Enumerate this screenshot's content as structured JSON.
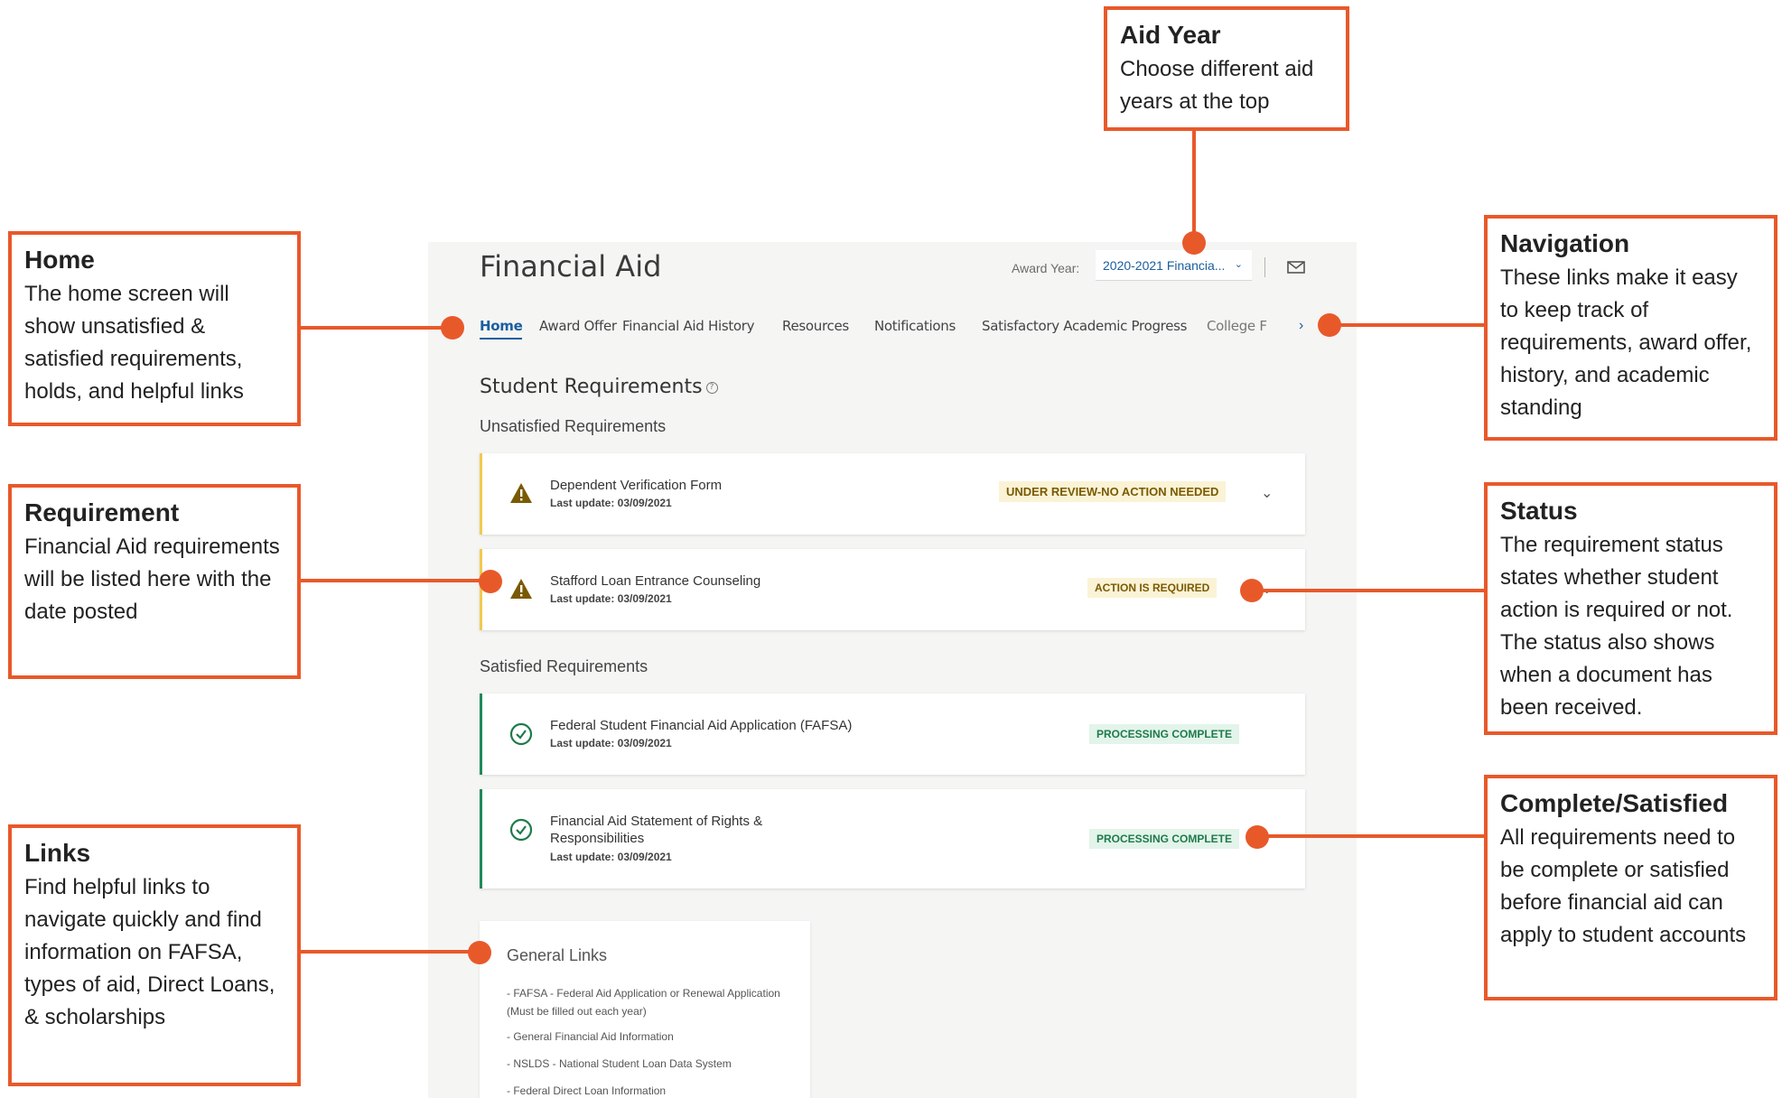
{
  "app": {
    "title": "Financial Aid",
    "award_year_label": "Award Year:",
    "award_year_value": "2020-2021 Financia...",
    "tabs": [
      "Home",
      "Award Offer",
      "Financial Aid History",
      "Resources",
      "Notifications",
      "Satisfactory Academic Progress",
      "College F"
    ],
    "student_requirements_title": "Student Requirements",
    "unsatisfied_title": "Unsatisfied Requirements",
    "satisfied_title": "Satisfied Requirements",
    "unsatisfied": [
      {
        "name": "Dependent Verification Form",
        "date": "Last update: 03/09/2021",
        "status": "UNDER REVIEW-NO ACTION NEEDED"
      },
      {
        "name": "Stafford Loan Entrance Counseling",
        "date": "Last update: 03/09/2021",
        "status": "ACTION IS REQUIRED"
      }
    ],
    "satisfied": [
      {
        "name": "Federal Student Financial Aid Application (FAFSA)",
        "date": "Last update: 03/09/2021",
        "status": "PROCESSING COMPLETE"
      },
      {
        "name_line1": "Financial Aid Statement of Rights &",
        "name_line2": "Responsibilities",
        "date": "Last update: 03/09/2021",
        "status": "PROCESSING COMPLETE"
      }
    ],
    "general_links_title": "General Links",
    "general_links": [
      "- FAFSA - Federal Aid Application or Renewal Application (Must be filled out each year)",
      "- General Financial Aid Information",
      "- NSLDS - National Student Loan Data System",
      "- Federal Direct Loan Information"
    ]
  },
  "callouts": {
    "aid_year": {
      "title": "Aid Year",
      "body": "Choose different aid years at the top"
    },
    "home": {
      "title": "Home",
      "body": "The home screen will show unsatisfied & satisfied requirements, holds, and helpful links"
    },
    "navigation": {
      "title": "Navigation",
      "body": "These links make it easy to keep track of  requirements, award offer, history, and academic standing"
    },
    "requirement": {
      "title": "Requirement",
      "body": "Financial Aid requirements will be listed here with the date posted"
    },
    "status": {
      "title": "Status",
      "body": "The requirement status states whether student action is required or not. The status also shows when a document has been received."
    },
    "links": {
      "title": "Links",
      "body": "Find helpful links to navigate quickly and find information on FAFSA, types of aid, Direct Loans, & scholarships"
    },
    "complete": {
      "title": "Complete/Satisfied",
      "body": "All requirements need to be complete or satisfied before financial aid can apply to student accounts"
    }
  },
  "colors": {
    "accent": "#e8592a",
    "link": "#1a5fa0",
    "warning_border": "#f2c94c",
    "ok_border": "#1e8a5a"
  }
}
